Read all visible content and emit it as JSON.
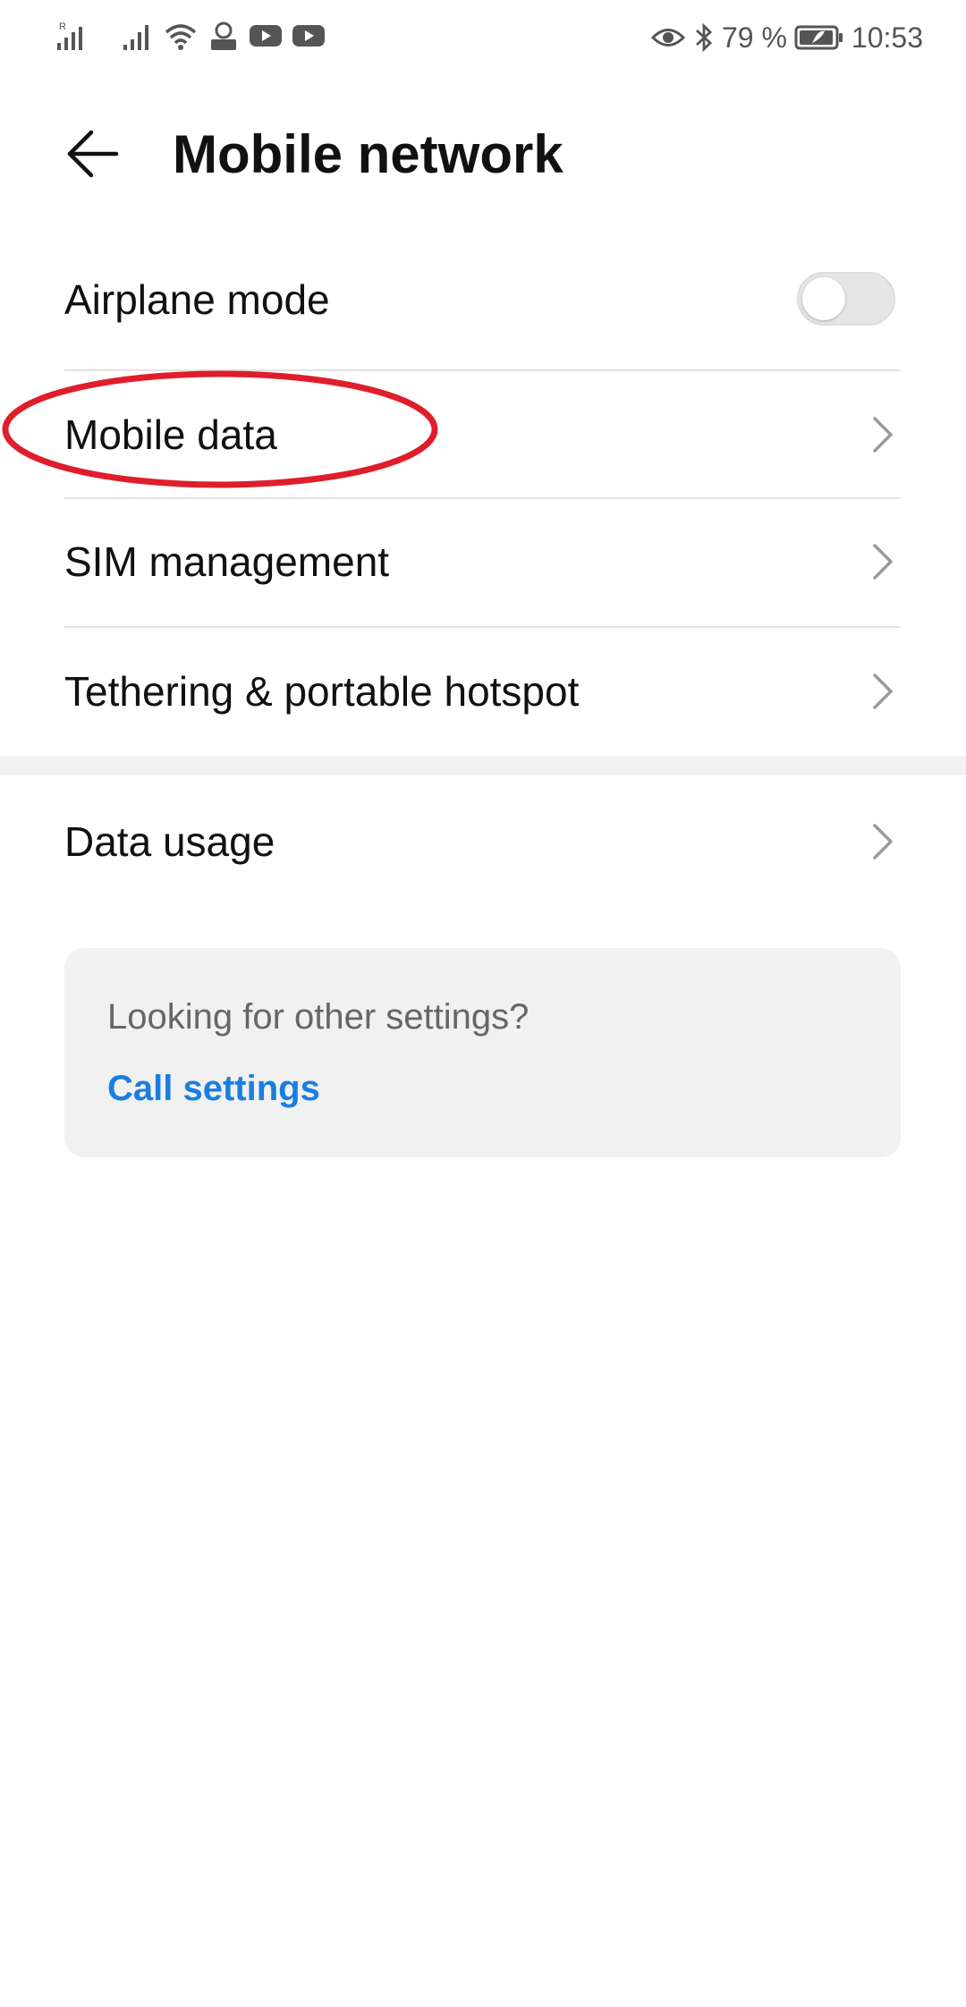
{
  "status_bar": {
    "battery_percent": "79 %",
    "time": "10:53",
    "left_icons": [
      "signal-r-icon",
      "signal-icon",
      "wifi-icon",
      "profile-app-icon",
      "youtube-icon",
      "youtube-icon"
    ],
    "right_icons": [
      "eye-comfort-icon",
      "bluetooth-icon",
      "battery-icon"
    ]
  },
  "header": {
    "title": "Mobile network",
    "back_icon": "back-arrow-icon"
  },
  "settings": {
    "airplane_mode": {
      "label": "Airplane mode",
      "enabled": false
    },
    "mobile_data": {
      "label": "Mobile data"
    },
    "sim_management": {
      "label": "SIM management"
    },
    "tethering": {
      "label": "Tethering & portable hotspot"
    },
    "data_usage": {
      "label": "Data usage"
    }
  },
  "card": {
    "hint": "Looking for other settings?",
    "link": "Call settings"
  },
  "colors": {
    "accent": "#1a7ee0",
    "annotation": "#e01e2b",
    "divider": "#e3e3e3",
    "card_bg": "#f1f1f1"
  }
}
